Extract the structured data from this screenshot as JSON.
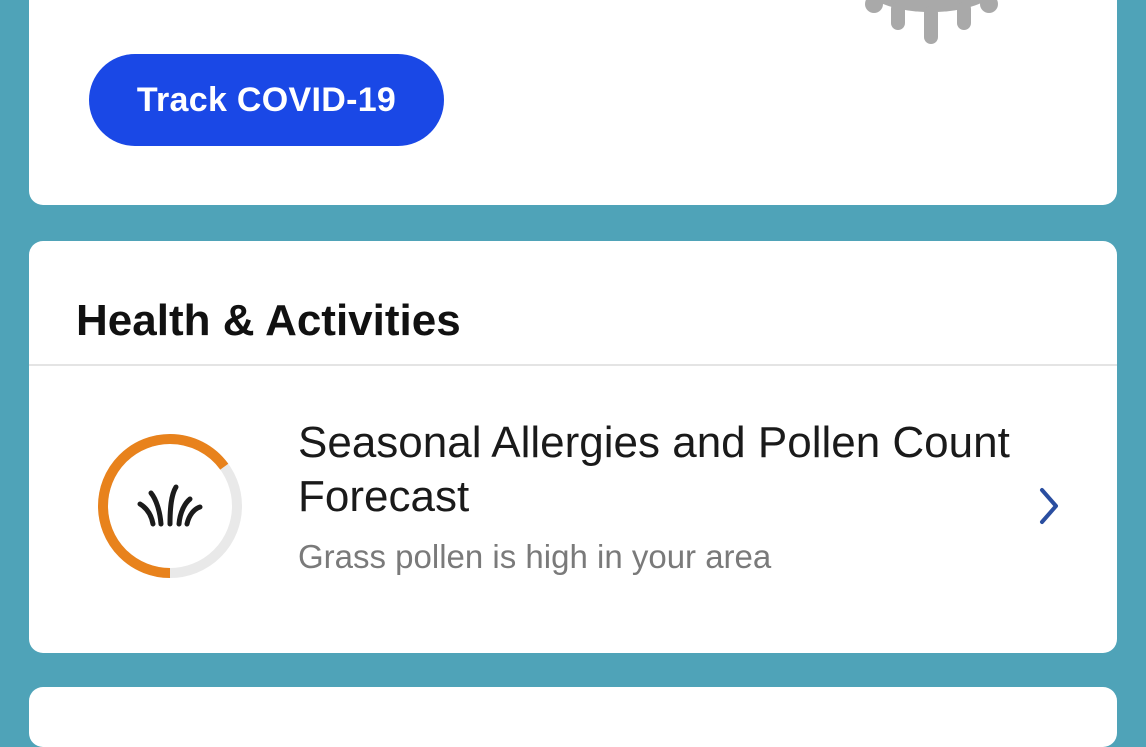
{
  "covid_card": {
    "button_label": "Track COVID-19",
    "icon": "virus-icon"
  },
  "health_card": {
    "title": "Health & Activities",
    "allergy_item": {
      "title": "Seasonal Allergies and Pollen Count Forecast",
      "subtitle": "Grass pollen is high in your area",
      "icon": "grass-icon",
      "gauge_level": 0.65,
      "gauge_color": "#e8821c",
      "chevron": "chevron-right-icon"
    }
  },
  "colors": {
    "background": "#4fa3b8",
    "button": "#1a48e6",
    "chevron": "#2a4ea0"
  }
}
